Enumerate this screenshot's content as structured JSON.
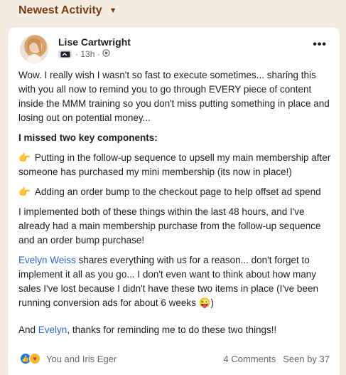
{
  "header": {
    "title": "Newest Activity"
  },
  "post": {
    "author": "Lise Cartwright",
    "time": "13h",
    "paragraphs": {
      "p1": "Wow. I really wish I wasn't so fast to execute sometimes... sharing this with you all now to remind you to go through EVERY piece of content inside the MMM training so you don't miss putting something in place and losing out on potential money...",
      "p2": "I missed two key components:",
      "p3": "Putting in the follow-up sequence to upsell my main membership after someone has purchased my mini membership (its now in place!)",
      "p4": "Adding an order bump to the checkout page to help offset ad spend",
      "p5": "I implemented both of these things within the last 48 hours, and I've already had a main membership purchase from the follow-up sequence and an order bump purchase!",
      "p6_mention": "Evelyn Weiss",
      "p6_rest": " shares everything with us for a reason... don't forget to implement it all as you go... I don't even want to think about how many sales I've lost because I didn't have these two items in place (I've been running conversion ads for about 6 weeks ",
      "p6_end": ")",
      "p7_start": "And ",
      "p7_mention": "Evelyn",
      "p7_rest": ", thanks for reminding me to do these two things!!"
    },
    "reactions_text": "You and Iris Eger",
    "comments": "4 Comments",
    "seen": "Seen by 37"
  },
  "colors": {
    "accent": "#7a3d10",
    "link": "#2d69c9",
    "background": "#f7ece1"
  },
  "icons": [
    "caret-down-icon",
    "avatar",
    "badge-icon",
    "globe-icon",
    "more-icon",
    "pointing-hand-icon",
    "grin-emoji-icon",
    "like-icon",
    "care-icon"
  ]
}
